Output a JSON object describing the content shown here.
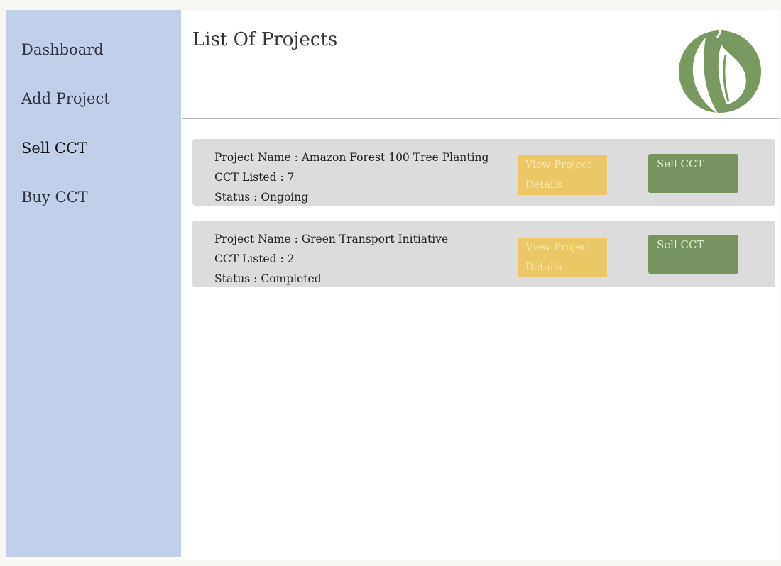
{
  "sidebar": {
    "items": [
      {
        "label": "Dashboard",
        "active": false
      },
      {
        "label": "Add Project",
        "active": false
      },
      {
        "label": "Sell CCT",
        "active": true
      },
      {
        "label": "Buy CCT",
        "active": false
      }
    ]
  },
  "header": {
    "title": "List Of Projects",
    "logo_icon": "leaf-logo-icon"
  },
  "projects": [
    {
      "name_line": "Project Name : Amazon Forest 100 Tree Planting",
      "cct_line": "CCT Listed : 7",
      "status_line": "Status : Ongoing",
      "view_label": "View Project Details",
      "sell_label": "Sell CCT"
    },
    {
      "name_line": "Project Name : Green Transport Initiative",
      "cct_line": "CCT Listed : 2",
      "status_line": "Status : Completed",
      "view_label": "View Project Details",
      "sell_label": "Sell CCT"
    }
  ],
  "colors": {
    "sidebar_bg": "#c2cfe8",
    "card_bg": "#dcdcdc",
    "view_button": "#ebc865",
    "sell_button": "#779460",
    "logo_green": "#7a9960"
  }
}
